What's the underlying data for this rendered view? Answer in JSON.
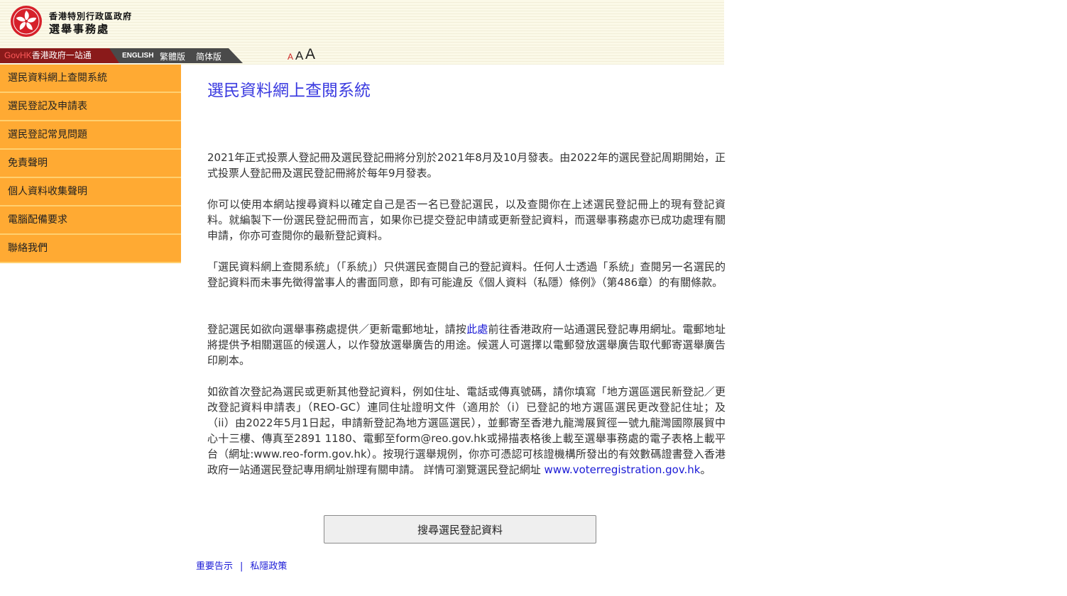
{
  "header": {
    "org_line1": "香港特別行政區政府",
    "org_line2": "選舉事務處",
    "emblem_icon": "bauhinia-emblem-icon",
    "emblem_color": "#d6202a"
  },
  "navbar": {
    "govhk_prefix": "GovHK",
    "govhk_label": "香港政府一站通",
    "languages": {
      "en": "ENGLISH",
      "tc": "繁體版",
      "sc": "简体版"
    },
    "font_size": {
      "small": "A",
      "medium": "A",
      "large": "A"
    }
  },
  "sidebar": {
    "items": [
      {
        "label": "選民資料網上查閱系統"
      },
      {
        "label": "選民登記及申請表"
      },
      {
        "label": "選民登記常見問題"
      },
      {
        "label": "免責聲明"
      },
      {
        "label": "個人資料收集聲明"
      },
      {
        "label": "電腦配備要求"
      },
      {
        "label": "聯絡我們"
      }
    ],
    "bg_color": "#ffaa33"
  },
  "main": {
    "title": "選民資料網上查閱系統",
    "p1": "2021年正式投票人登記冊及選民登記冊將分別於2021年8月及10月發表。由2022年的選民登記周期開始，正式投票人登記冊及選民登記冊將於每年9月發表。",
    "p2": "你可以使用本網站搜尋資料以確定自己是否一名已登記選民，以及查閱你在上述選民登記冊上的現有登記資料。就編製下一份選民登記冊而言，如果你已提交登記申請或更新登記資料，而選舉事務處亦已成功處理有關申請，你亦可查閱你的最新登記資料。",
    "p3": "「選民資料網上查閱系統」（「系統」）只供選民查閱自己的登記資料。任何人士透過「系統」查閱另一名選民的登記資料而未事先徵得當事人的書面同意，即有可能違反《個人資料（私隱）條例》（第486章）的有關條款。",
    "p4_before": "登記選民如欲向選舉事務處提供／更新電郵地址，請按",
    "p4_link": "此處",
    "p4_after": "前往香港政府一站通選民登記專用網址。電郵地址將提供予相關選區的候選人，以作發放選舉廣告的用途。候選人可選擇以電郵發放選舉廣告取代郵寄選舉廣告印刷本。",
    "p5_before": "如欲首次登記為選民或更新其他登記資料，例如住址、電話或傳真號碼，請你填寫「地方選區選民新登記／更改登記資料申請表」（REO-GC）連同住址證明文件（適用於（i）已登記的地方選區選民更改登記住址；及（ii）由2022年5月1日起，申請新登記為地方選區選民），並郵寄至香港九龍灣展貿徑一號九龍灣國際展貿中心十三樓、傳真至2891 1180、電郵至form@reo.gov.hk或掃描表格後上載至選舉事務處的電子表格上載平台（網址:www.reo-form.gov.hk）。按現行選舉規例，你亦可憑認可核證機構所發出的有效數碼證書登入香港政府一站通選民登記專用網址辦理有關申請。 詳情可瀏覽選民登記網址 ",
    "p5_link": "www.voterregistration.gov.hk",
    "p5_after": "。",
    "search_button": "搜尋選民登記資料",
    "title_color": "#3a3ae0",
    "link_color": "#1a1ad6"
  },
  "footer": {
    "important_notices": "重要告示",
    "separator": "|",
    "privacy_policy": "私隱政策"
  }
}
